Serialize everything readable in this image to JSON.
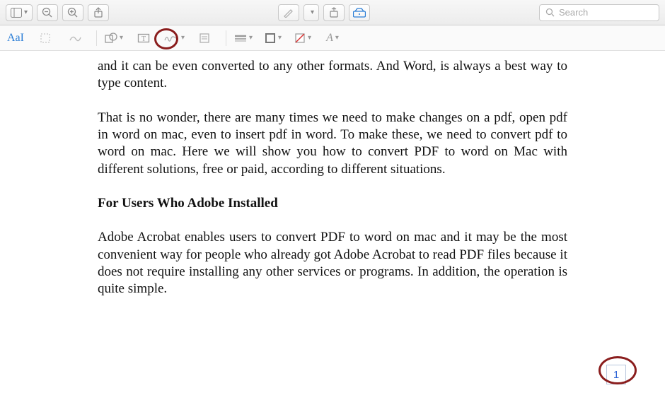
{
  "toolbar": {
    "search_placeholder": "Search",
    "markup_color": "#2a7dd6"
  },
  "subtoolbar": {
    "aal_label": "AaI",
    "font_tool_label": "A"
  },
  "document": {
    "para_cut": "and it can be even converted to any other formats. And Word, is always a best way to type content.",
    "para_2": "That is no wonder, there are many times we need to make changes on a pdf, open pdf in word on mac, even to insert pdf in word. To make these, we need to convert pdf to word on mac. Here we will show you how to convert PDF to word on Mac with different solutions, free or paid, according to different situations.",
    "heading": "For Users Who Adobe Installed",
    "para_3": "Adobe Acrobat enables users to convert PDF to word on mac and it may be the most convenient way for people who already got Adobe Acrobat to read PDF files because it does not require installing any other services or programs. In addition, the operation is quite simple.",
    "page_number": "1"
  }
}
